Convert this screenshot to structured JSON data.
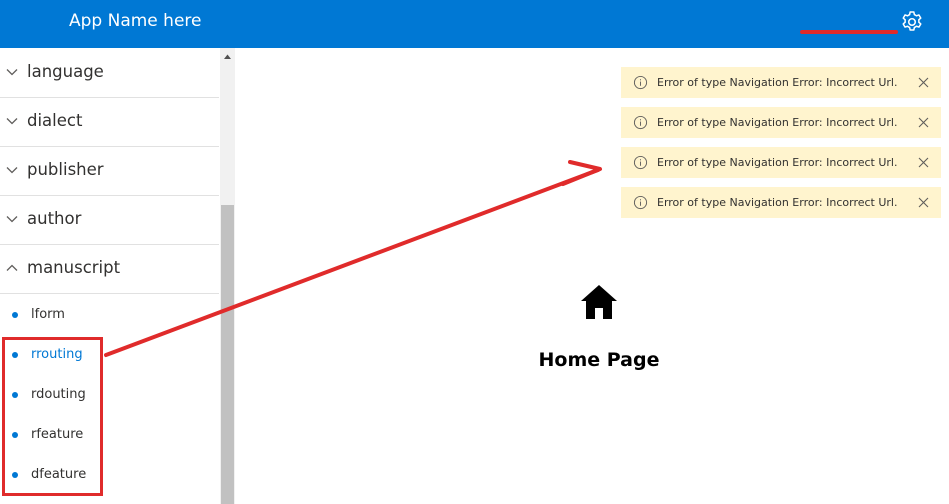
{
  "app": {
    "title": "App Name here"
  },
  "colors": {
    "accent": "#0078d4",
    "warning_bg": "#fff4ce",
    "annotation": "#e02b2b"
  },
  "sidebar": {
    "groups": [
      {
        "label": "language",
        "expanded": false,
        "icon": "chevron-down-icon"
      },
      {
        "label": "dialect",
        "expanded": false,
        "icon": "chevron-down-icon"
      },
      {
        "label": "publisher",
        "expanded": false,
        "icon": "chevron-down-icon"
      },
      {
        "label": "author",
        "expanded": false,
        "icon": "chevron-down-icon"
      },
      {
        "label": "manuscript",
        "expanded": true,
        "icon": "chevron-up-icon"
      }
    ],
    "items": [
      {
        "label": "lform",
        "active": false
      },
      {
        "label": "rrouting",
        "active": true
      },
      {
        "label": "rdouting",
        "active": false
      },
      {
        "label": "rfeature",
        "active": false
      },
      {
        "label": "dfeature",
        "active": false
      }
    ]
  },
  "messages": [
    {
      "text": "Error of type Navigation Error: Incorrect Url.",
      "icon": "info-icon"
    },
    {
      "text": "Error of type Navigation Error: Incorrect Url.",
      "icon": "info-icon"
    },
    {
      "text": "Error of type Navigation Error: Incorrect Url.",
      "icon": "info-icon"
    },
    {
      "text": "Error of type Navigation Error: Incorrect Url.",
      "icon": "info-icon"
    }
  ],
  "main": {
    "title": "Home Page",
    "icon": "home-icon"
  }
}
